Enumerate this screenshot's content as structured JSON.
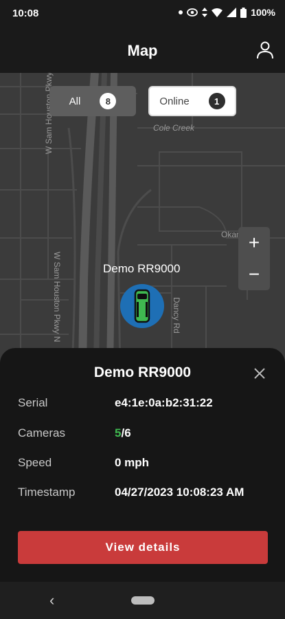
{
  "status_bar": {
    "time": "10:08",
    "battery": "100%"
  },
  "header": {
    "title": "Map"
  },
  "filters": {
    "all": {
      "label": "All",
      "count": "8"
    },
    "online": {
      "label": "Online",
      "count": "1"
    }
  },
  "map": {
    "labels": {
      "cole_creek": "Cole Creek",
      "w_sam_upper": "W Sam Houston Pkwy N",
      "w_sam_lower": "W Sam Houston Pkwy N",
      "okan": "Okan",
      "dancy": "Dancy Rd"
    },
    "zoom_in": "+",
    "zoom_out": "−"
  },
  "vehicle": {
    "name": "Demo RR9000",
    "marker_color": "#1e6fb5",
    "vehicle_color": "#3fb950"
  },
  "sheet": {
    "title": "Demo RR9000",
    "rows": [
      {
        "label": "Serial",
        "value": "e4:1e:0a:b2:31:22"
      },
      {
        "label": "Cameras",
        "online": "5",
        "total": "/6"
      },
      {
        "label": "Speed",
        "value": "0 mph"
      },
      {
        "label": "Timestamp",
        "value": "04/27/2023 10:08:23 AM"
      }
    ],
    "button_label": "View details"
  },
  "colors": {
    "accent": "#c93b3b",
    "online": "#3fb950"
  }
}
